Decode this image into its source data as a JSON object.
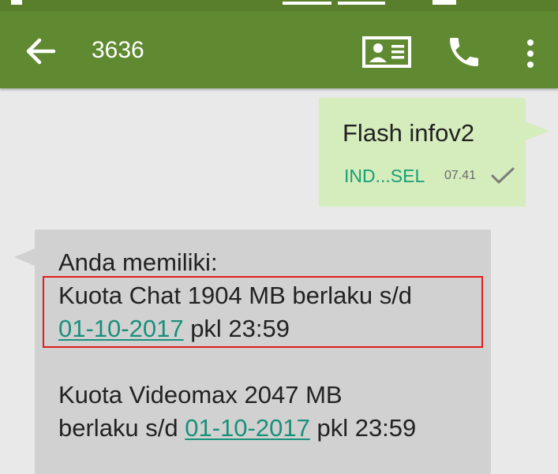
{
  "header": {
    "title": "3636",
    "back_icon": "arrow-left-icon",
    "contact_icon": "contact-card-icon",
    "call_icon": "phone-icon",
    "menu_icon": "more-vert-icon"
  },
  "colors": {
    "app_bar": "#608a32",
    "status_bar": "#5a7f2c",
    "outgoing_bubble": "#d5ecbc",
    "incoming_bubble": "#d1d1d1",
    "link": "#19907a",
    "sim_label": "#16a078",
    "highlight": "#e11c1c"
  },
  "messages": {
    "outgoing": {
      "text": "Flash infov2",
      "sim": "IND...SEL",
      "time": "07.41",
      "status_icon": "check-icon"
    },
    "incoming": {
      "line1": "Anda memiliki:",
      "line2": "Kuota Chat 1904 MB berlaku s/d",
      "line3_date": "01-10-2017",
      "line3_rest": " pkl 23:59",
      "line4": "Kuota Videomax 2047 MB",
      "line5_prefix": "berlaku s/d ",
      "line5_date": "01-10-2017",
      "line5_rest": " pkl 23:59"
    }
  }
}
